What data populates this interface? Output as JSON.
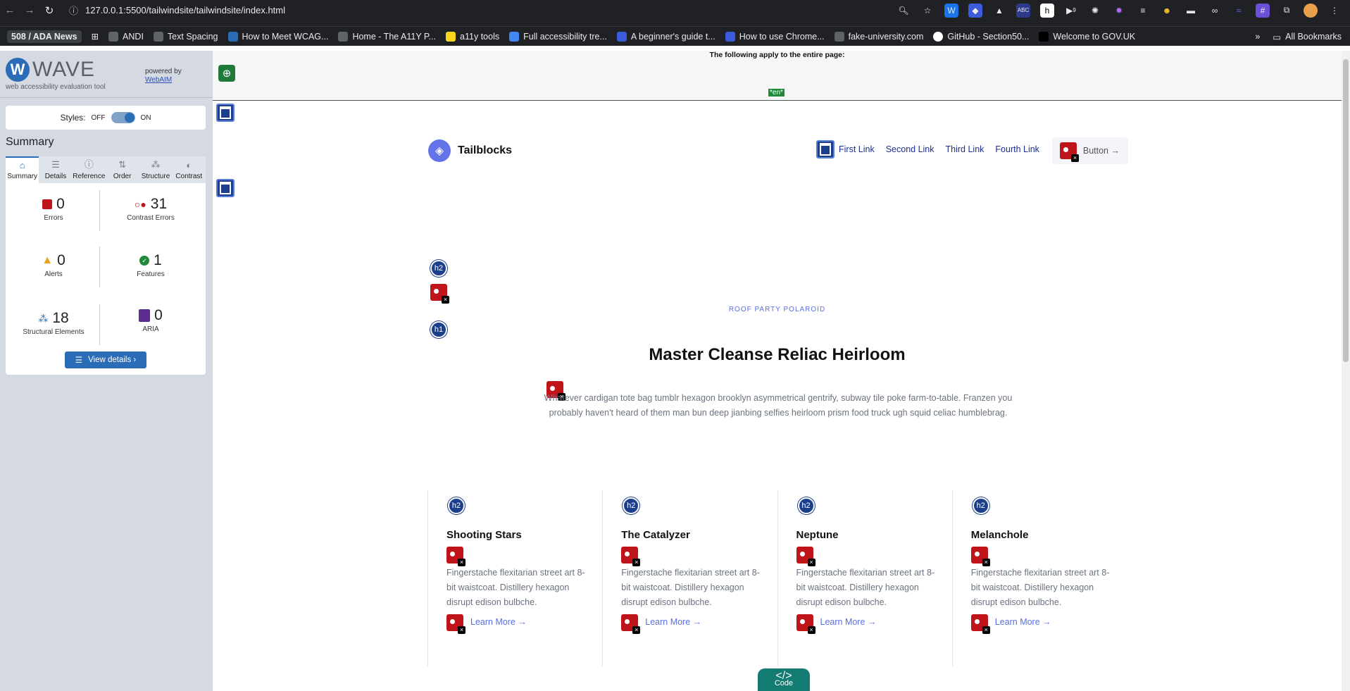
{
  "browser": {
    "url": "127.0.0.1:5500/tailwindsite/tailwindsite/index.html",
    "bookmarks": [
      "508 / ADA News",
      "ANDI",
      "Text Spacing",
      "How to Meet WCAG...",
      "Home - The A11Y P...",
      "a11y tools",
      "Full accessibility tre...",
      "A beginner's guide t...",
      "How to use Chrome...",
      "fake-university.com",
      "GitHub - Section50...",
      "Welcome to GOV.UK"
    ],
    "bookmarks_right": "All Bookmarks",
    "ext_badge": "9"
  },
  "wave": {
    "brand": "WAVE",
    "tagline": "web accessibility evaluation tool",
    "powered_by": "powered by",
    "webaim": "WebAIM",
    "styles_label": "Styles:",
    "off": "OFF",
    "on": "ON",
    "summary_title": "Summary",
    "tabs": [
      "Summary",
      "Details",
      "Reference",
      "Order",
      "Structure",
      "Contrast"
    ],
    "stats": {
      "errors": {
        "value": "0",
        "label": "Errors"
      },
      "contrast": {
        "value": "31",
        "label": "Contrast Errors"
      },
      "alerts": {
        "value": "0",
        "label": "Alerts"
      },
      "features": {
        "value": "1",
        "label": "Features"
      },
      "structural": {
        "value": "18",
        "label": "Structural Elements"
      },
      "aria": {
        "value": "0",
        "label": "ARIA"
      }
    },
    "view_details": "View details ›"
  },
  "page": {
    "apply_text": "The following apply to the entire page:",
    "lang": "en",
    "brand": "Tailblocks",
    "nav": [
      "First Link",
      "Second Link",
      "Third Link",
      "Fourth Link"
    ],
    "button": "Button →",
    "eyebrow": "ROOF PARTY POLAROID",
    "heading": "Master Cleanse Reliac Heirloom",
    "paragraph": "Whatever cardigan tote bag tumblr hexagon brooklyn asymmetrical gentrify, subway tile poke farm-to-table. Franzen you probably haven't heard of them man bun deep jianbing selfies heirloom prism food truck ugh squid celiac humblebrag.",
    "cards": [
      {
        "title": "Shooting Stars",
        "text": "Fingerstache flexitarian street art 8-bit waistcoat. Distillery hexagon disrupt edison bulbche.",
        "link": "Learn More →"
      },
      {
        "title": "The Catalyzer",
        "text": "Fingerstache flexitarian street art 8-bit waistcoat. Distillery hexagon disrupt edison bulbche.",
        "link": "Learn More →"
      },
      {
        "title": "Neptune",
        "text": "Fingerstache flexitarian street art 8-bit waistcoat. Distillery hexagon disrupt edison bulbche.",
        "link": "Learn More →"
      },
      {
        "title": "Melanchole",
        "text": "Fingerstache flexitarian street art 8-bit waistcoat. Distillery hexagon disrupt edison bulbche.",
        "link": "Learn More →"
      }
    ],
    "h2": "h2",
    "h1": "h1",
    "code": "Code"
  }
}
